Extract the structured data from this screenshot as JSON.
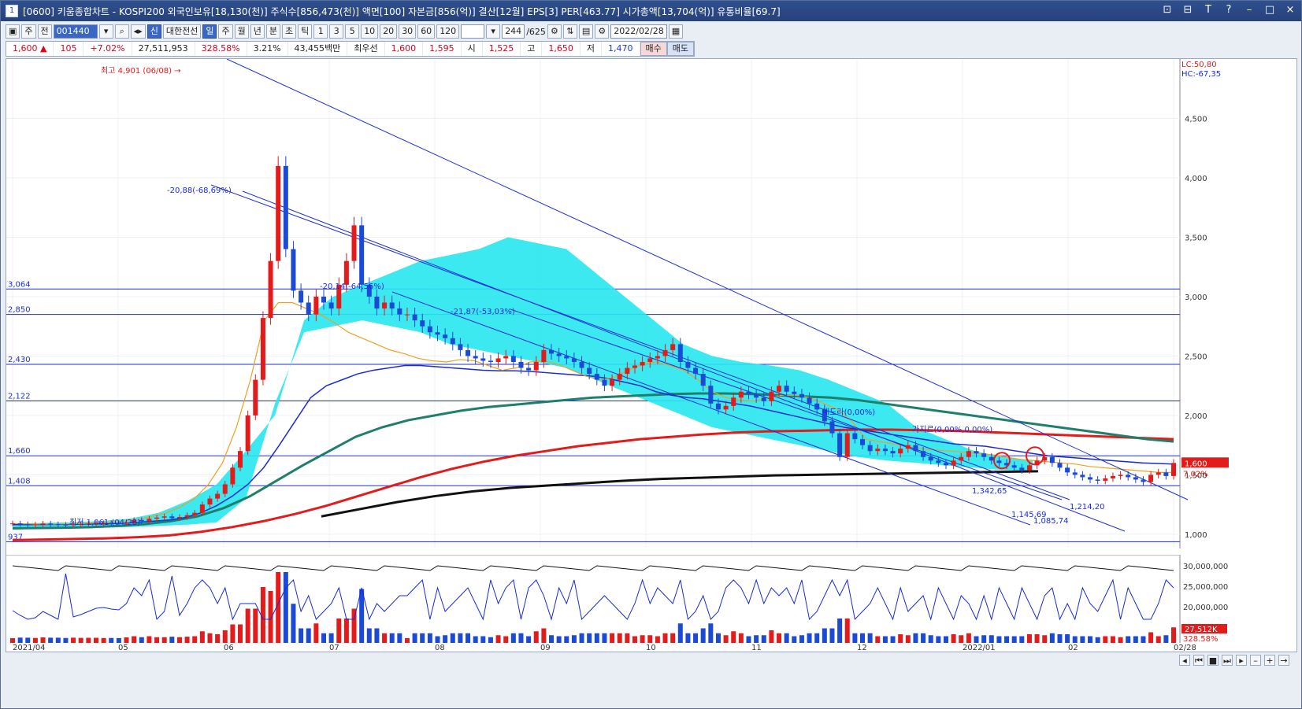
{
  "titlebar": {
    "app_icon": "1",
    "title": "[0600] 키움종합차트 - KOSPI200 외국인보유[18,130(천)] 주식수[856,473(천)] 액면[100] 자본금[856(억)] 결산[12월] EPS[3] PER[463.77] 시가총액[13,704(억)] 유통비율[69.7]",
    "controls": [
      "⊡",
      "⊟",
      "T",
      "?",
      "–",
      "□",
      "×"
    ]
  },
  "toolbar1": {
    "market": "주",
    "all": "전",
    "code": "001440",
    "company_badge": "신",
    "company": "대한전선",
    "periods": [
      "일",
      "주",
      "월",
      "년",
      "분",
      "초",
      "틱"
    ],
    "active_period": "일",
    "intervals": [
      "1",
      "3",
      "5",
      "10",
      "20",
      "30",
      "60",
      "120"
    ],
    "count": "244",
    "total": "/625",
    "date": "2022/02/28"
  },
  "quote": {
    "price": "1,600",
    "change": "105",
    "change_pct": "+7.02%",
    "volume": "27,511,953",
    "volume_ratio": "328.58%",
    "turnover": "3.21%",
    "amount": "43,455백만",
    "best_bid_label": "최우선",
    "best_ask": "1,600",
    "best_bid": "1,595",
    "open_label": "시",
    "open": "1,525",
    "high_label": "고",
    "high": "1,650",
    "low_label": "저",
    "low": "1,470",
    "buy": "매수",
    "sell": "매도"
  },
  "chart_labels": {
    "lc_hc_top": "LC:50,80",
    "lc_hc_bottom": "HC:-67,35",
    "max_label": "최고 4,901 (06/08)",
    "min_label": "최저 1,061 (04/28)",
    "fib1": "-20,88(-68,69%)",
    "fib2": "-20,14(-64,56%)",
    "fib3": "-21,87(-53,03%)",
    "annot1": "매도라(0,00%)",
    "annot2": "가지르(0,00%,0,00%)",
    "l1": "1,342,65",
    "l2": "1,214,20",
    "l3": "1,145,69",
    "l4": "1,085,74",
    "price_tag": "1,600",
    "pct_tag": "7.02%",
    "vol_tag": "27,512K",
    "vol_pct_tag": "328.58%"
  },
  "chart_data": {
    "type": "candlestick",
    "title": "",
    "x_ticks": [
      "2021/04",
      "05",
      "06",
      "07",
      "08",
      "09",
      "10",
      "11",
      "12",
      "2022/01",
      "02",
      "02/28"
    ],
    "y_ticks": [
      1000,
      1500,
      2000,
      2500,
      3000,
      3500,
      4000,
      4500
    ],
    "ylim": [
      880,
      5000
    ],
    "hlines": [
      3064,
      2850,
      2430,
      2122,
      1660,
      1408,
      937
    ],
    "hline_labels": [
      "3,064",
      "2,850",
      "2,430",
      "2,122",
      "1,660",
      "1,408",
      "937"
    ],
    "vol_ticks": [
      "30,000,000",
      "25,000,000",
      "20,000,000"
    ],
    "close": [
      1091,
      1085,
      1080,
      1082,
      1090,
      1085,
      1080,
      1078,
      1083,
      1086,
      1090,
      1094,
      1095,
      1093,
      1092,
      1100,
      1120,
      1110,
      1130,
      1140,
      1150,
      1135,
      1145,
      1160,
      1180,
      1250,
      1300,
      1340,
      1420,
      1560,
      1700,
      2000,
      2300,
      2820,
      3300,
      4100,
      3400,
      3050,
      2950,
      2850,
      3000,
      2950,
      2900,
      3100,
      3300,
      3600,
      3100,
      3000,
      2900,
      2950,
      2900,
      2850,
      2850,
      2800,
      2750,
      2700,
      2680,
      2650,
      2600,
      2550,
      2500,
      2480,
      2460,
      2450,
      2480,
      2500,
      2450,
      2400,
      2380,
      2450,
      2550,
      2520,
      2500,
      2480,
      2450,
      2400,
      2350,
      2300,
      2250,
      2300,
      2350,
      2400,
      2420,
      2450,
      2480,
      2500,
      2550,
      2600,
      2450,
      2400,
      2350,
      2250,
      2100,
      2050,
      2080,
      2150,
      2200,
      2180,
      2150,
      2120,
      2200,
      2250,
      2200,
      2180,
      2150,
      2100,
      2050,
      1950,
      1850,
      1650,
      1850,
      1800,
      1750,
      1700,
      1720,
      1700,
      1680,
      1720,
      1750,
      1700,
      1650,
      1620,
      1600,
      1580,
      1620,
      1650,
      1700,
      1680,
      1650,
      1620,
      1600,
      1580,
      1560,
      1540,
      1580,
      1620,
      1650,
      1600,
      1560,
      1520,
      1500,
      1480,
      1460,
      1450,
      1470,
      1490,
      1500,
      1480,
      1460,
      1440,
      1500,
      1520,
      1490,
      1600
    ],
    "ma_fast": [
      1090,
      1088,
      1086,
      1085,
      1088,
      1090,
      1095,
      1100,
      1110,
      1125,
      1150,
      1180,
      1230,
      1300,
      1420,
      1600,
      1900,
      2300,
      2800,
      2950,
      2950,
      2900,
      2850,
      2780,
      2700,
      2650,
      2600,
      2550,
      2520,
      2480,
      2460,
      2450,
      2470,
      2460,
      2420,
      2380,
      2400,
      2450,
      2460,
      2430,
      2380,
      2330,
      2300,
      2320,
      2380,
      2430,
      2450,
      2420,
      2380,
      2300,
      2200,
      2150,
      2130,
      2120,
      2150,
      2170,
      2170,
      2150,
      2100,
      2050,
      1950,
      1800,
      1780,
      1760,
      1740,
      1720,
      1710,
      1700,
      1690,
      1680,
      1670,
      1650,
      1630,
      1620,
      1610,
      1600,
      1590,
      1570,
      1560,
      1550,
      1540,
      1530,
      1520,
      1520
    ],
    "ma_mid": [
      1080,
      1080,
      1081,
      1082,
      1084,
      1086,
      1088,
      1092,
      1100,
      1110,
      1120,
      1140,
      1180,
      1240,
      1320,
      1420,
      1560,
      1750,
      1950,
      2150,
      2250,
      2300,
      2350,
      2380,
      2400,
      2420,
      2420,
      2410,
      2400,
      2390,
      2380,
      2375,
      2375,
      2370,
      2360,
      2350,
      2340,
      2330,
      2310,
      2280,
      2250,
      2200,
      2170,
      2150,
      2140,
      2120,
      2100,
      2080,
      2050,
      2020,
      1990,
      1960,
      1930,
      1900,
      1880,
      1860,
      1840,
      1820,
      1800,
      1780,
      1760,
      1750,
      1740,
      1720,
      1700,
      1680,
      1660,
      1650,
      1640,
      1630,
      1620,
      1610,
      1600,
      1595,
      1590
    ],
    "ma_slow": [
      1050,
      1052,
      1055,
      1060,
      1070,
      1085,
      1110,
      1150,
      1220,
      1320,
      1450,
      1580,
      1700,
      1820,
      1900,
      1960,
      2000,
      2040,
      2070,
      2090,
      2110,
      2130,
      2150,
      2160,
      2170,
      2180,
      2185,
      2185,
      2180,
      2170,
      2160,
      2150,
      2130,
      2100,
      2070,
      2040,
      2010,
      1980,
      1950,
      1920,
      1890,
      1860,
      1830,
      1800,
      1780
    ],
    "ma_long": [
      950,
      955,
      960,
      965,
      975,
      990,
      1020,
      1060,
      1110,
      1170,
      1240,
      1320,
      1400,
      1480,
      1550,
      1610,
      1660,
      1700,
      1740,
      1770,
      1800,
      1820,
      1840,
      1855,
      1865,
      1870,
      1875,
      1880,
      1880,
      1875,
      1870,
      1860,
      1850,
      1840,
      1830,
      1820,
      1810,
      1800
    ],
    "trend_black": [
      1150,
      1210,
      1270,
      1320,
      1360,
      1390,
      1410,
      1430,
      1450,
      1465,
      1475,
      1485,
      1495,
      1500,
      1505,
      1510,
      1515,
      1520,
      1525,
      1530
    ]
  }
}
